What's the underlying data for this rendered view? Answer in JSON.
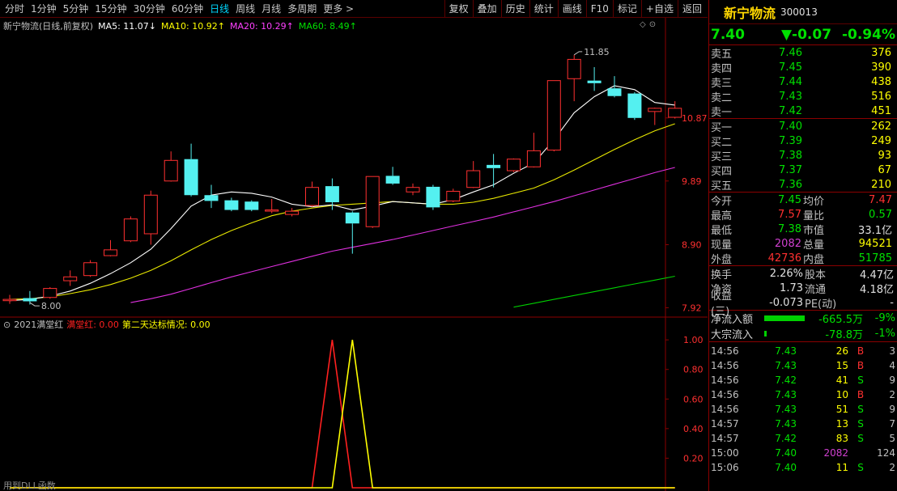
{
  "toolbar": {
    "periods": [
      "分时",
      "1分钟",
      "5分钟",
      "15分钟",
      "30分钟",
      "60分钟",
      "日线",
      "周线",
      "月线",
      "多周期",
      "更多 >"
    ],
    "active_index": 6,
    "buttons": [
      "复权",
      "叠加",
      "历史",
      "统计",
      "画线",
      "F10",
      "标记",
      "+自选",
      "返回"
    ]
  },
  "ma_legend": {
    "title": "新宁物流(日线,前复权)",
    "ma5": "MA5: 11.07↓",
    "ma10": "MA10: 10.92↑",
    "ma20": "MA20: 10.29↑",
    "ma60": "MA60: 8.49↑"
  },
  "indicator_legend": {
    "name": "2021满堂红",
    "s1": "满堂红: 0.00",
    "s2": "第二天达标情况: 0.00"
  },
  "bottom_note": "用到DLL函数",
  "chart_data": [
    {
      "type": "candlestick",
      "title": "新宁物流(日线,前复权)",
      "y_ticks": [
        "10.87",
        "9.89",
        "8.90",
        "7.92"
      ],
      "y_tick_values": [
        10.87,
        9.89,
        8.9,
        7.92
      ],
      "ylim": [
        7.8,
        12.2
      ],
      "annotations": [
        {
          "label": "11.85",
          "value": 11.85
        },
        {
          "label": "8.00",
          "value": 8.0
        }
      ],
      "candles": [
        {
          "o": 8.03,
          "c": 8.05,
          "h": 8.12,
          "l": 7.98
        },
        {
          "o": 8.07,
          "c": 8.02,
          "h": 8.18,
          "l": 7.97
        },
        {
          "o": 8.08,
          "c": 8.22,
          "h": 8.24,
          "l": 8.06
        },
        {
          "o": 8.34,
          "c": 8.4,
          "h": 8.5,
          "l": 8.26
        },
        {
          "o": 8.42,
          "c": 8.62,
          "h": 8.66,
          "l": 8.4
        },
        {
          "o": 8.73,
          "c": 8.82,
          "h": 8.97,
          "l": 8.72
        },
        {
          "o": 8.96,
          "c": 9.3,
          "h": 9.34,
          "l": 8.94
        },
        {
          "o": 9.07,
          "c": 9.67,
          "h": 9.74,
          "l": 8.9
        },
        {
          "o": 9.89,
          "c": 10.21,
          "h": 10.35,
          "l": 9.88
        },
        {
          "o": 10.23,
          "c": 9.67,
          "h": 10.47,
          "l": 9.65
        },
        {
          "o": 9.67,
          "c": 9.58,
          "h": 9.83,
          "l": 9.47
        },
        {
          "o": 9.59,
          "c": 9.44,
          "h": 9.63,
          "l": 9.42
        },
        {
          "o": 9.57,
          "c": 9.44,
          "h": 9.59,
          "l": 9.42
        },
        {
          "o": 9.44,
          "c": 9.44,
          "h": 9.61,
          "l": 9.39
        },
        {
          "o": 9.37,
          "c": 9.42,
          "h": 9.47,
          "l": 9.34
        },
        {
          "o": 9.51,
          "c": 9.79,
          "h": 9.88,
          "l": 9.49
        },
        {
          "o": 9.81,
          "c": 9.56,
          "h": 9.93,
          "l": 9.44
        },
        {
          "o": 9.4,
          "c": 9.23,
          "h": 9.42,
          "l": 8.76
        },
        {
          "o": 9.18,
          "c": 9.96,
          "h": 9.96,
          "l": 9.16
        },
        {
          "o": 9.97,
          "c": 9.85,
          "h": 10.11,
          "l": 9.83
        },
        {
          "o": 9.72,
          "c": 9.79,
          "h": 9.85,
          "l": 9.67
        },
        {
          "o": 9.8,
          "c": 9.48,
          "h": 9.83,
          "l": 9.44
        },
        {
          "o": 9.58,
          "c": 9.73,
          "h": 9.77,
          "l": 9.56
        },
        {
          "o": 9.79,
          "c": 10.05,
          "h": 10.2,
          "l": 9.78
        },
        {
          "o": 10.14,
          "c": 10.09,
          "h": 10.31,
          "l": 9.79
        },
        {
          "o": 10.05,
          "c": 10.23,
          "h": 10.24,
          "l": 10.03
        },
        {
          "o": 10.11,
          "c": 10.36,
          "h": 10.64,
          "l": 10.1
        },
        {
          "o": 10.37,
          "c": 11.45,
          "h": 11.45,
          "l": 10.35
        },
        {
          "o": 11.48,
          "c": 11.78,
          "h": 11.85,
          "l": 11.13
        },
        {
          "o": 11.45,
          "c": 11.41,
          "h": 11.66,
          "l": 11.29
        },
        {
          "o": 11.33,
          "c": 11.21,
          "h": 11.52,
          "l": 11.19
        },
        {
          "o": 11.25,
          "c": 10.87,
          "h": 11.27,
          "l": 10.84
        },
        {
          "o": 10.97,
          "c": 11.02,
          "h": 11.03,
          "l": 10.76
        },
        {
          "o": 10.88,
          "c": 11.02,
          "h": 11.13,
          "l": 10.86
        }
      ],
      "ma5": [
        8.03,
        8.05,
        8.1,
        8.18,
        8.3,
        8.45,
        8.62,
        8.83,
        9.15,
        9.5,
        9.67,
        9.72,
        9.7,
        9.64,
        9.53,
        9.49,
        9.52,
        9.44,
        9.5,
        9.57,
        9.55,
        9.53,
        9.6,
        9.72,
        9.83,
        10.01,
        10.17,
        10.53,
        10.95,
        11.2,
        11.37,
        11.31,
        11.11,
        11.07
      ],
      "ma10": [
        8.05,
        8.06,
        8.09,
        8.14,
        8.2,
        8.28,
        8.38,
        8.5,
        8.65,
        8.82,
        8.98,
        9.12,
        9.24,
        9.35,
        9.42,
        9.47,
        9.51,
        9.53,
        9.55,
        9.57,
        9.55,
        9.53,
        9.53,
        9.56,
        9.62,
        9.7,
        9.78,
        9.91,
        10.06,
        10.22,
        10.38,
        10.53,
        10.67,
        10.78
      ],
      "ma20": [
        null,
        null,
        null,
        null,
        null,
        null,
        8.0,
        8.06,
        8.13,
        8.22,
        8.31,
        8.4,
        8.48,
        8.56,
        8.64,
        8.72,
        8.8,
        8.86,
        8.92,
        8.98,
        9.05,
        9.12,
        9.19,
        9.26,
        9.33,
        9.41,
        9.49,
        9.57,
        9.66,
        9.75,
        9.84,
        9.93,
        10.02,
        10.1
      ],
      "ma60": [
        null,
        null,
        null,
        null,
        null,
        null,
        null,
        null,
        null,
        null,
        null,
        null,
        null,
        null,
        null,
        null,
        null,
        null,
        null,
        null,
        null,
        null,
        null,
        null,
        null,
        7.93,
        7.99,
        8.05,
        8.11,
        8.17,
        8.23,
        8.29,
        8.35,
        8.41
      ]
    },
    {
      "type": "line",
      "title": "2021满堂红",
      "y_ticks": [
        "1.00",
        "0.80",
        "0.60",
        "0.40",
        "0.20"
      ],
      "ylim": [
        0,
        1.05
      ],
      "series": [
        {
          "name": "满堂红",
          "color": "#ff2020",
          "values": [
            0,
            0,
            0,
            0,
            0,
            0,
            0,
            0,
            0,
            0,
            0,
            0,
            0,
            0,
            0,
            0,
            1,
            0,
            0,
            0,
            0,
            0,
            0,
            0,
            0,
            0,
            0,
            0,
            0,
            0,
            0,
            0,
            0,
            0
          ]
        },
        {
          "name": "第二天达标情况",
          "color": "#ffff00",
          "values": [
            0,
            0,
            0,
            0,
            0,
            0,
            0,
            0,
            0,
            0,
            0,
            0,
            0,
            0,
            0,
            0,
            0,
            1,
            0,
            0,
            0,
            0,
            0,
            0,
            0,
            0,
            0,
            0,
            0,
            0,
            0,
            0,
            0,
            0
          ]
        }
      ]
    }
  ],
  "quote": {
    "name": "新宁物流",
    "code": "300013",
    "price": "7.40",
    "change": "▼-0.07",
    "pct": "-0.94%",
    "asks": [
      {
        "label": "卖五",
        "price": "7.46",
        "vol": "376"
      },
      {
        "label": "卖四",
        "price": "7.45",
        "vol": "390"
      },
      {
        "label": "卖三",
        "price": "7.44",
        "vol": "438"
      },
      {
        "label": "卖二",
        "price": "7.43",
        "vol": "516"
      },
      {
        "label": "卖一",
        "price": "7.42",
        "vol": "451"
      }
    ],
    "bids": [
      {
        "label": "买一",
        "price": "7.40",
        "vol": "262"
      },
      {
        "label": "买二",
        "price": "7.39",
        "vol": "249"
      },
      {
        "label": "买三",
        "price": "7.38",
        "vol": "93"
      },
      {
        "label": "买四",
        "price": "7.37",
        "vol": "67"
      },
      {
        "label": "买五",
        "price": "7.36",
        "vol": "210"
      }
    ],
    "stats1": [
      {
        "l1": "今开",
        "v1": "7.45",
        "c1": "#00e000",
        "l2": "均价",
        "v2": "7.47",
        "c2": "#ff3030"
      },
      {
        "l1": "最高",
        "v1": "7.57",
        "c1": "#ff3030",
        "l2": "量比",
        "v2": "0.57",
        "c2": "#00e000"
      },
      {
        "l1": "最低",
        "v1": "7.38",
        "c1": "#00e000",
        "l2": "市值",
        "v2": "33.1亿",
        "c2": "#e0e0e0"
      },
      {
        "l1": "现量",
        "v1": "2082",
        "c1": "#d040d0",
        "l2": "总量",
        "v2": "94521",
        "c2": "#ffff00"
      },
      {
        "l1": "外盘",
        "v1": "42736",
        "c1": "#ff3030",
        "l2": "内盘",
        "v2": "51785",
        "c2": "#00e000"
      }
    ],
    "stats2": [
      {
        "l1": "换手",
        "v1": "2.26%",
        "l2": "股本",
        "v2": "4.47亿"
      },
      {
        "l1": "净资",
        "v1": "1.73",
        "l2": "流通",
        "v2": "4.18亿"
      },
      {
        "l1": "收益(三)",
        "v1": "-0.073",
        "l2": "PE(动)",
        "v2": "-"
      }
    ],
    "flows": [
      {
        "label": "净流入额",
        "bar": 0.9,
        "val": "-665.5万",
        "pct": "-9%"
      },
      {
        "label": "大宗流入",
        "bar": 0.05,
        "val": "-78.8万",
        "pct": "-1%"
      }
    ],
    "ticks": [
      {
        "time": "14:56",
        "price": "7.43",
        "vol": "26",
        "bs": "B",
        "n": "3",
        "vc": "#ffff00"
      },
      {
        "time": "14:56",
        "price": "7.43",
        "vol": "15",
        "bs": "B",
        "n": "4",
        "vc": "#ffff00"
      },
      {
        "time": "14:56",
        "price": "7.42",
        "vol": "41",
        "bs": "S",
        "n": "9",
        "vc": "#ffff00"
      },
      {
        "time": "14:56",
        "price": "7.43",
        "vol": "10",
        "bs": "B",
        "n": "2",
        "vc": "#ffff00"
      },
      {
        "time": "14:56",
        "price": "7.43",
        "vol": "51",
        "bs": "S",
        "n": "9",
        "vc": "#ffff00"
      },
      {
        "time": "14:57",
        "price": "7.43",
        "vol": "13",
        "bs": "S",
        "n": "7",
        "vc": "#ffff00"
      },
      {
        "time": "14:57",
        "price": "7.42",
        "vol": "83",
        "bs": "S",
        "n": "5",
        "vc": "#ffff00"
      },
      {
        "time": "15:00",
        "price": "7.40",
        "vol": "2082",
        "bs": "",
        "n": "124",
        "vc": "#d040d0"
      },
      {
        "time": "15:06",
        "price": "7.40",
        "vol": "11",
        "bs": "S",
        "n": "2",
        "vc": "#ffff00"
      }
    ]
  }
}
